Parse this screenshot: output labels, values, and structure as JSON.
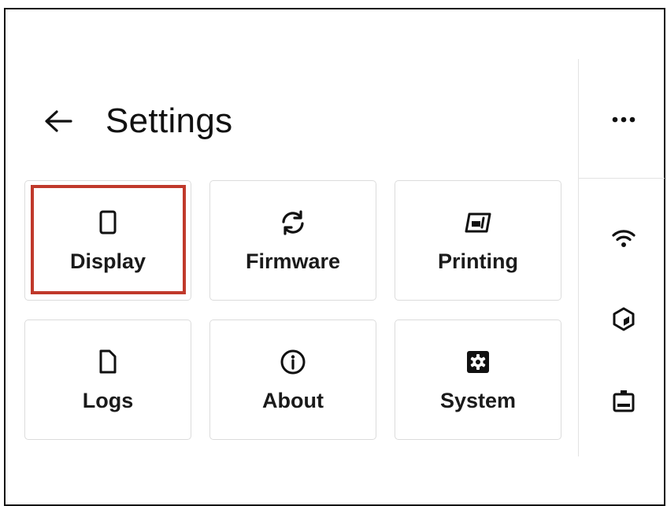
{
  "header": {
    "title": "Settings",
    "back_icon": "arrow-left-icon",
    "more_icon": "more-horizontal-icon"
  },
  "tiles": [
    {
      "label": "Display",
      "icon": "tablet-icon",
      "highlighted": true
    },
    {
      "label": "Firmware",
      "icon": "refresh-icon"
    },
    {
      "label": "Printing",
      "icon": "printer-bed-icon"
    },
    {
      "label": "Logs",
      "icon": "file-icon"
    },
    {
      "label": "About",
      "icon": "info-icon"
    },
    {
      "label": "System",
      "icon": "gear-box-icon"
    }
  ],
  "status_bar": {
    "icons": [
      "wifi-icon",
      "filament-cube-icon",
      "printer-icon"
    ]
  },
  "colors": {
    "highlight": "#c0392b",
    "text": "#111111",
    "tile_border": "#dcdcdc"
  }
}
